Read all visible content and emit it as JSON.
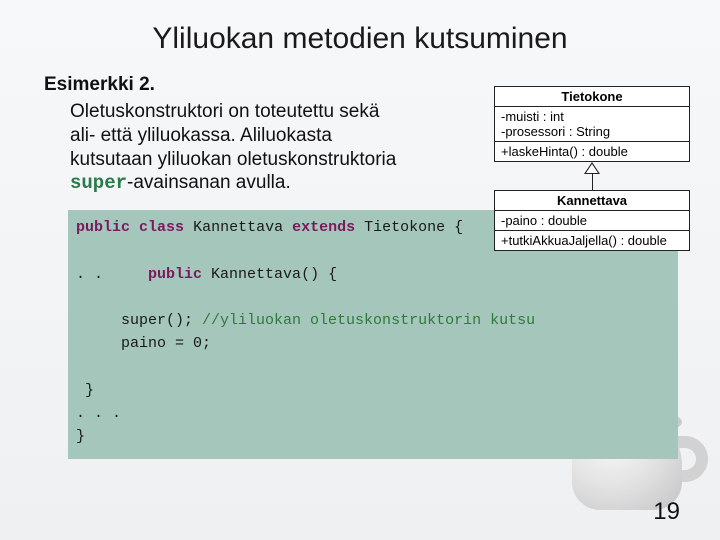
{
  "title": "Yliluokan metodien kutsuminen",
  "example_label": "Esimerkki 2.",
  "paragraph": {
    "line1": "Oletuskonstruktori on toteutettu sekä",
    "line2": "ali- että yliluokassa. Aliluokasta",
    "line3": "kutsutaan yliluokan oletuskonstruktoria",
    "super_kw": "super",
    "line4_rest": "-avainsanan avulla."
  },
  "uml": {
    "class1": {
      "name": "Tietokone",
      "attr1": "-muisti : int",
      "attr2": "-prosessori : String",
      "op1": "+laskeHinta() : double"
    },
    "class2": {
      "name": "Kannettava",
      "attr1": "-paino : double",
      "op1": "+tutkiAkkuaJaljella() : double"
    }
  },
  "code": {
    "kw_public": "public",
    "kw_class": "class",
    "kw_extends": "extends",
    "cls_child": "Kannettava",
    "cls_parent": "Tietokone",
    "dots": ". .",
    "method_sig_rest": " Kannettava() {",
    "call": "super();",
    "comment": " //yliluokan oletuskonstruktorin kutsu",
    "assign": "paino = 0;",
    "close_brace": "}",
    "ellipsis": ". . .",
    "close_brace2": "}"
  },
  "slide_number": "19"
}
